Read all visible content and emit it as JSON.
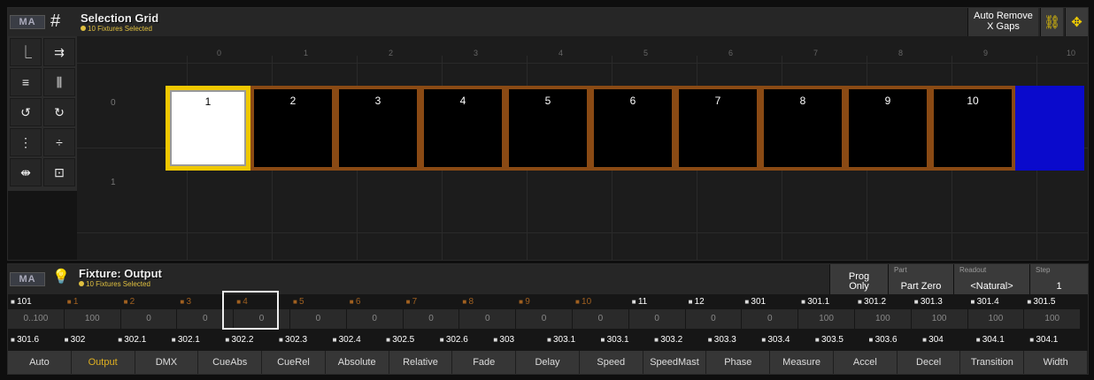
{
  "selection_grid": {
    "logo": "MA",
    "title": "Selection Grid",
    "subtitle": "10 Fixtures Selected",
    "auto_remove_line1": "Auto Remove",
    "auto_remove_line2": "X Gaps",
    "columns": [
      "0",
      "1",
      "2",
      "3",
      "4",
      "5",
      "6",
      "7",
      "8",
      "9",
      "10"
    ],
    "rows": [
      "0",
      "1"
    ],
    "cells": [
      "1",
      "2",
      "3",
      "4",
      "5",
      "6",
      "7",
      "8",
      "9",
      "10"
    ],
    "selected_cell": "1",
    "colors": {
      "cell_border": "#8a4a14",
      "selected_border": "#f0c800",
      "blue": "#0a0acc"
    }
  },
  "fixture_output": {
    "logo": "MA",
    "title": "Fixture: Output",
    "subtitle": "10 Fixtures Selected",
    "prog_only_line1": "Prog",
    "prog_only_line2": "Only",
    "part_label": "Part",
    "part_value": "Part Zero",
    "readout_label": "Readout",
    "readout_value": "<Natural>",
    "step_label": "Step",
    "step_value": "1",
    "row1": [
      "101",
      "1",
      "2",
      "3",
      "4",
      "5",
      "6",
      "7",
      "8",
      "9",
      "10",
      "11",
      "12",
      "301",
      "301.1",
      "301.2",
      "301.3",
      "301.4",
      "301.5"
    ],
    "row2": [
      "0..100",
      "100",
      "0",
      "0",
      "0",
      "0",
      "0",
      "0",
      "0",
      "0",
      "0",
      "0",
      "0",
      "0",
      "100",
      "100",
      "100",
      "100",
      "100"
    ],
    "row3": [
      "301.6",
      "302",
      "302.1",
      "302.1",
      "302.2",
      "302.3",
      "302.4",
      "302.5",
      "302.6",
      "303",
      "303.1",
      "303.1",
      "303.2",
      "303.3",
      "303.4",
      "303.5",
      "303.6",
      "304",
      "304.1",
      "304.1"
    ],
    "tabs": [
      "Auto",
      "Output",
      "DMX",
      "CueAbs",
      "CueRel",
      "Absolute",
      "Relative",
      "Fade",
      "Delay",
      "Speed",
      "SpeedMast",
      "Phase",
      "Measure",
      "Accel",
      "Decel",
      "Transition",
      "Width"
    ],
    "active_tab": "Output"
  }
}
